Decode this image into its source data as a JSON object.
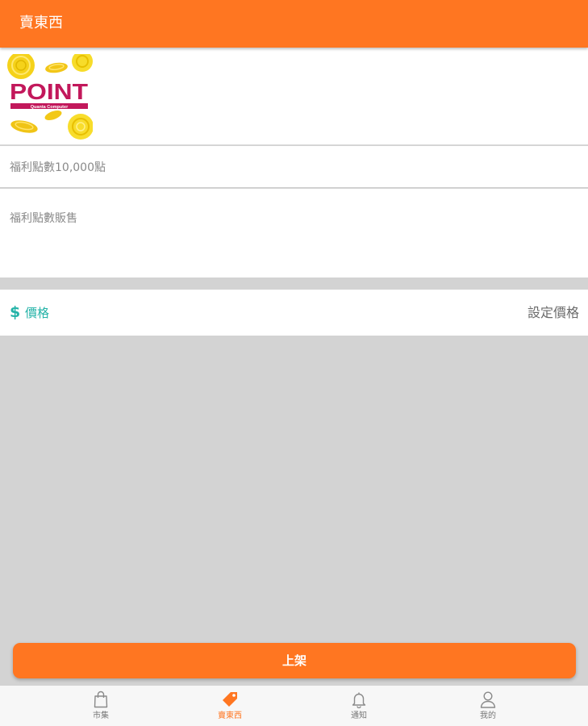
{
  "appbar": {
    "title": "賣東西"
  },
  "listing": {
    "image": {
      "alt": "POINT Quanta Computer",
      "logo_text": "POINT",
      "logo_subtext": "Quanta Computer"
    },
    "title_value": "福利點數10,000點",
    "description_value": "福利點數販售",
    "price_label": "價格",
    "price_icon": "$",
    "price_action": "設定價格"
  },
  "submit": {
    "label": "上架"
  },
  "bottom_nav": {
    "items": [
      {
        "label": "市集",
        "icon": "shopping-bag-icon",
        "active": false
      },
      {
        "label": "賣東西",
        "icon": "price-tag-icon",
        "active": true
      },
      {
        "label": "通知",
        "icon": "bell-icon",
        "active": false
      },
      {
        "label": "我的",
        "icon": "user-icon",
        "active": false
      }
    ]
  },
  "colors": {
    "accent": "#ff7621",
    "price_teal": "#24b3a8",
    "background_gray": "#d3d3d3"
  }
}
